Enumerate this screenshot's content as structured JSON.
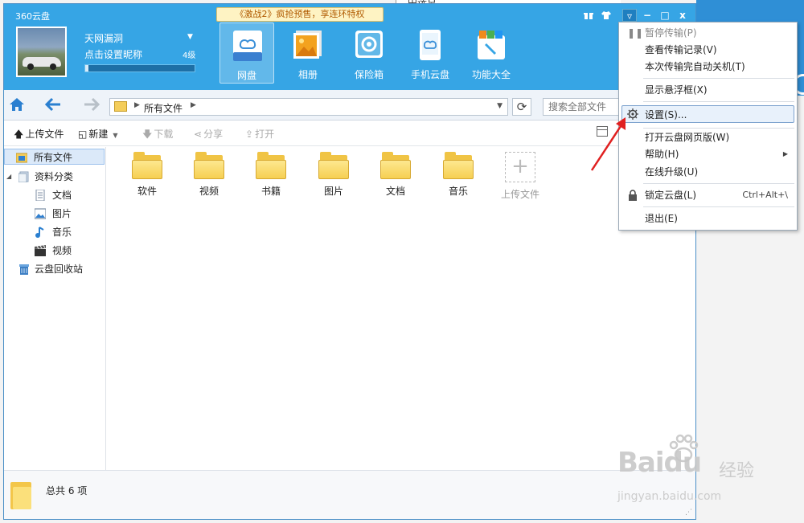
{
  "bg_window": {
    "label": "中选总"
  },
  "app": {
    "title": "360云盘",
    "promo": "《激战2》疯抢预售，享连环特权",
    "controls": {
      "gift": "♯",
      "skin": "▲",
      "menu": "▿",
      "minimize": "−",
      "maximize": "□",
      "close": "x"
    }
  },
  "user": {
    "name": "天网漏洞",
    "nickname_prompt": "点击设置昵称",
    "level": "4级",
    "quota_fraction": 0.03
  },
  "nav_tabs": [
    {
      "label": "网盘",
      "icon": "cloud-drive-icon",
      "active": true
    },
    {
      "label": "相册",
      "icon": "photo-album-icon",
      "active": false
    },
    {
      "label": "保险箱",
      "icon": "safe-icon",
      "active": false
    },
    {
      "label": "手机云盘",
      "icon": "mobile-cloud-icon",
      "active": false
    },
    {
      "label": "功能大全",
      "icon": "toolbox-icon",
      "active": false
    }
  ],
  "address": {
    "path": "所有文件",
    "search_placeholder": "搜索全部文件"
  },
  "toolbar": {
    "upload": "上传文件",
    "new": "新建",
    "download": "下载",
    "share": "分享",
    "open": "打开"
  },
  "sidebar": {
    "all_files": "所有文件",
    "categories": "资料分类",
    "docs": "文档",
    "images": "图片",
    "music": "音乐",
    "video": "视频",
    "recycle": "云盘回收站"
  },
  "folders": [
    "软件",
    "视频",
    "书籍",
    "图片",
    "文档",
    "音乐"
  ],
  "upload_tile": "上传文件",
  "status": {
    "text": "总共 6 项"
  },
  "menu": {
    "pause": "暂停传输(P)",
    "history": "查看传输记录(V)",
    "shutdown": "本次传输完自动关机(T)",
    "float": "显示悬浮框(X)",
    "settings": "设置(S)...",
    "web": "打开云盘网页版(W)",
    "help": "帮助(H)",
    "upgrade": "在线升级(U)",
    "lock": "锁定云盘(L)",
    "lock_shortcut": "Ctrl+Alt+\\",
    "exit": "退出(E)"
  },
  "watermark": {
    "brand": "Baidu",
    "cn": "经验",
    "url": "jingyan.baidu.com"
  },
  "colors": {
    "header": "#36a5e5",
    "accent": "#e02020",
    "folder": "#f0c445"
  }
}
